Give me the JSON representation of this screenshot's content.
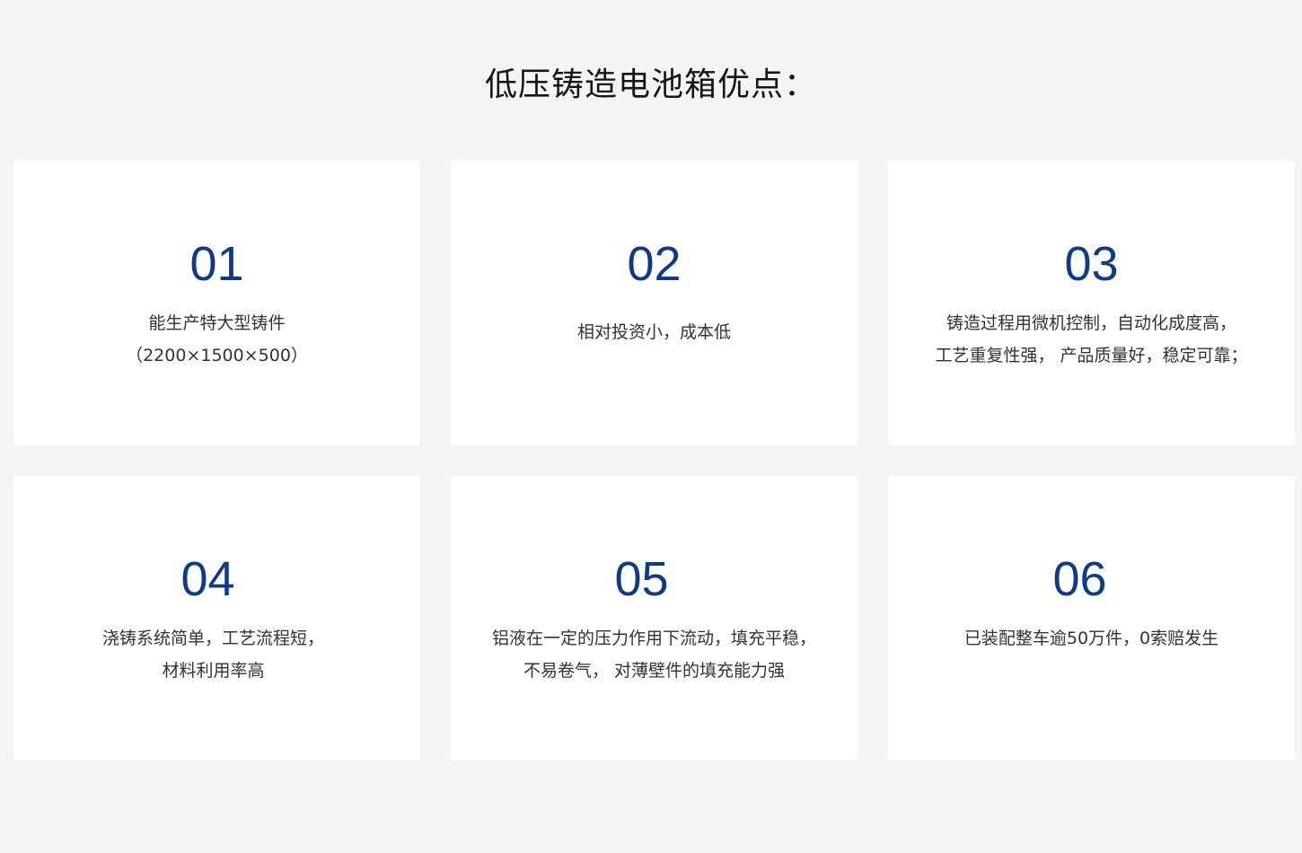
{
  "page": {
    "title": "低压铸造电池箱优点："
  },
  "cards": [
    {
      "number": "01",
      "lines": [
        "能生产特大型铸件",
        "（2200×1500×500）"
      ]
    },
    {
      "number": "02",
      "lines": [
        "相对投资小，成本低"
      ]
    },
    {
      "number": "03",
      "lines": [
        "铸造过程用微机控制，自动化成度高，",
        "工艺重复性强， 产品质量好，稳定可靠；"
      ]
    },
    {
      "number": "04",
      "lines": [
        "浇铸系统简单，工艺流程短，",
        "材料利用率高"
      ]
    },
    {
      "number": "05",
      "lines": [
        "铝液在一定的压力作用下流动，填充平稳，",
        "不易卷气， 对薄壁件的填充能力强"
      ]
    },
    {
      "number": "06",
      "lines": [
        "已装配整车逾50万件，0索赔发生"
      ]
    }
  ],
  "colors": {
    "background": "#f4f4f4",
    "card": "#ffffff",
    "accent_number": "#0e3a87",
    "title": "#151515",
    "text": "#333333"
  }
}
